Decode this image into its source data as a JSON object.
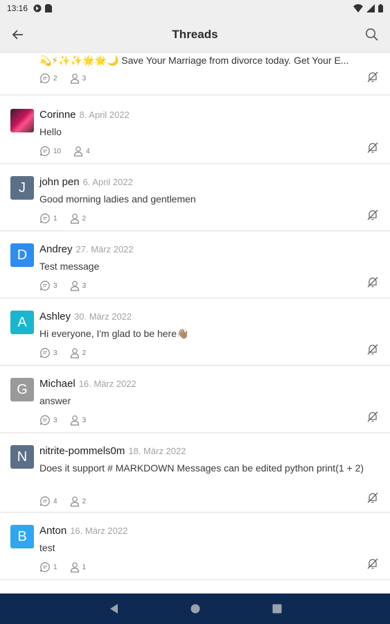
{
  "status_bar": {
    "time": "13:16"
  },
  "app_bar": {
    "title": "Threads"
  },
  "partial_thread": {
    "emoji": "💫⚡✨✨🌟🌟🌙",
    "message": " Save Your Marriage from divorce today. Get Your E...",
    "replies": "2",
    "participants": "3"
  },
  "threads": [
    {
      "name": "Corinne",
      "date": "8. April 2022",
      "message": "Hello",
      "replies": "10",
      "participants": "4",
      "avatar_type": "photo",
      "avatar_letter": "",
      "avatar_color": ""
    },
    {
      "name": "john pen",
      "date": "6. April 2022",
      "message": "Good morning ladies and gentlemen",
      "replies": "1",
      "participants": "2",
      "avatar_type": "letter",
      "avatar_letter": "J",
      "avatar_color": "#5b7087"
    },
    {
      "name": "Andrey",
      "date": "27. März 2022",
      "message": "Test message",
      "replies": "3",
      "participants": "3",
      "avatar_type": "letter",
      "avatar_letter": "D",
      "avatar_color": "#2f8cf0"
    },
    {
      "name": "Ashley",
      "date": "30. März 2022",
      "message": "Hi everyone, I'm glad to be here👋🏽",
      "replies": "3",
      "participants": "2",
      "avatar_type": "letter",
      "avatar_letter": "A",
      "avatar_color": "#18b7cf"
    },
    {
      "name": "Michael",
      "date": "16. März 2022",
      "message": "answer",
      "replies": "3",
      "participants": "3",
      "avatar_type": "letter",
      "avatar_letter": "G",
      "avatar_color": "#9a9a9a"
    },
    {
      "name": "nitrite-pommels0m",
      "date": "18. März 2022",
      "message": "Does it support # MARKDOWN Messages can be edited python print(1 + 2)",
      "replies": "4",
      "participants": "2",
      "avatar_type": "letter",
      "avatar_letter": "N",
      "avatar_color": "#5b7087"
    },
    {
      "name": "Anton",
      "date": "16. März 2022",
      "message": "test",
      "replies": "1",
      "participants": "1",
      "avatar_type": "letter",
      "avatar_letter": "B",
      "avatar_color": "#2fa7f0"
    }
  ],
  "colors": {
    "nav_bar": "#0e2a52",
    "divider": "#eeeeee",
    "date": "#a2a2a2"
  },
  "icons": {
    "back": "arrow-left-icon",
    "search": "search-icon",
    "replies": "comment-icon",
    "participants": "person-icon",
    "mute": "bell-off-icon"
  }
}
